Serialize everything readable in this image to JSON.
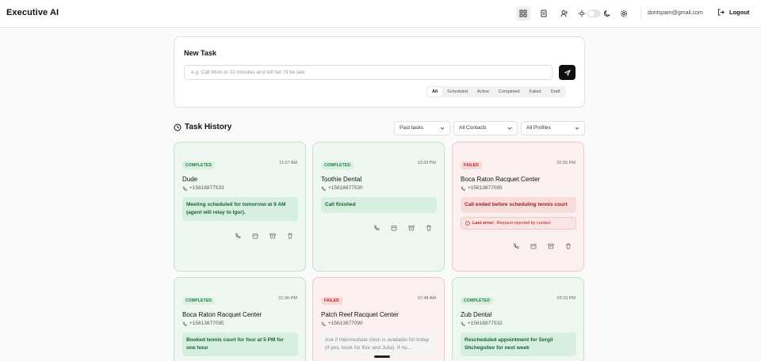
{
  "app": {
    "title": "Executive AI"
  },
  "header": {
    "icons": [
      "grid-icon",
      "document-icon",
      "users-icon",
      "sun-icon",
      "moon-icon",
      "gear-icon"
    ],
    "email": "dontspam@gmail.com",
    "logout_label": "Logout"
  },
  "new_task": {
    "title": "New Task",
    "placeholder": "e.g. Call Mom in 10 minutes and tell her I'll be late",
    "filters": [
      "All",
      "Scheduled",
      "Active",
      "Completed",
      "Failed",
      "Draft"
    ],
    "active_filter": "All"
  },
  "history": {
    "title": "Task History",
    "dropdowns": {
      "range": "Past tasks",
      "contacts": "All Contacts",
      "profiles": "All Profiles"
    }
  },
  "cards": [
    {
      "status": "COMPLETED",
      "time": "11:07 AM",
      "name": "Dude",
      "phone": "+15618877533",
      "result": "Meeting scheduled for tomorrow at 9 AM (agent will relay to Igor)."
    },
    {
      "status": "COMPLETED",
      "time": "10:33 PM",
      "name": "Toothie Dental",
      "phone": "+15618877530",
      "result": "Call finished"
    },
    {
      "status": "FAILED",
      "time": "01:55 PM",
      "name": "Boca Raton Racquet Center",
      "phone": "+15613677095",
      "result": "Call ended before scheduling tennis court",
      "last_error_label": "Last error:",
      "last_error": "Request rejected by contact"
    },
    {
      "status": "COMPLETED",
      "time": "01:36 PM",
      "name": "Boca Raton Racquet Center",
      "phone": "+15613677095",
      "result": "Booked tennis court for four at 5 PM for one hour"
    },
    {
      "status": "FAILED",
      "time": "07:48 AM",
      "name": "Patch Reef Racquet Center",
      "phone": "+15613677090",
      "result": "Ask if Intermediate clinic is available for today (if yes, book for Ihor and Julia). If no..."
    },
    {
      "status": "COMPLETED",
      "time": "03:23 PM",
      "name": "Zub Dental",
      "phone": "+15618877532",
      "result": "Rescheduled appointment for Sergii Shchegoliev for next week"
    }
  ],
  "colors": {
    "completed": "#15803d",
    "failed": "#b91c1c",
    "accent": "#111111"
  }
}
